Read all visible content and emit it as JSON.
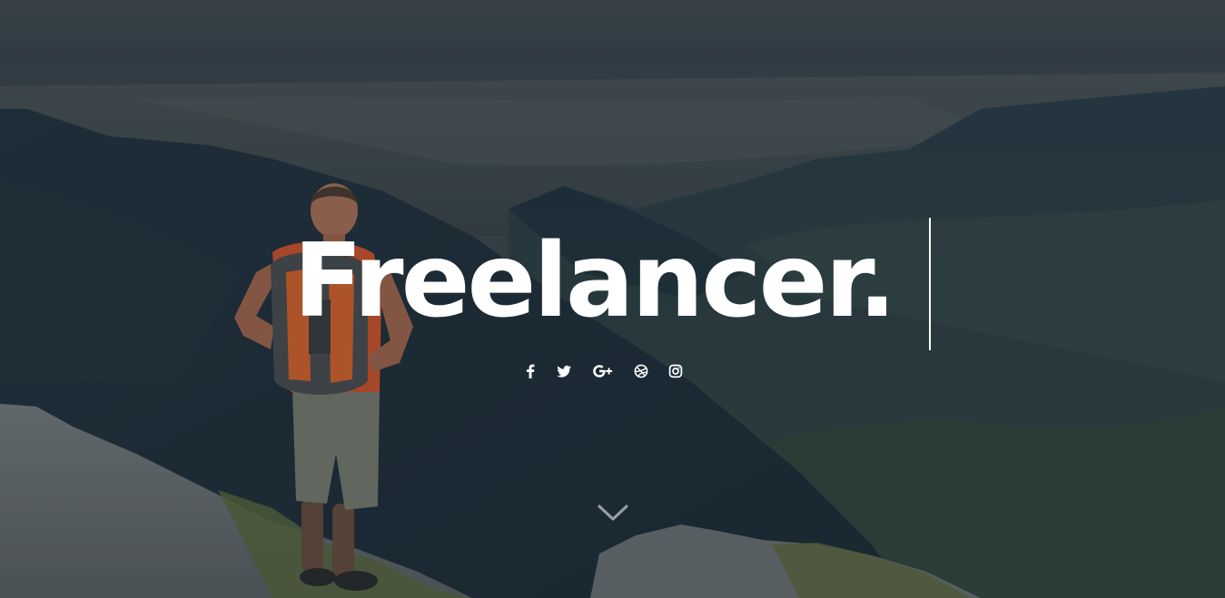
{
  "hero": {
    "headline": "Freelancer."
  },
  "social_links": [
    {
      "name": "facebook",
      "icon": "facebook-icon"
    },
    {
      "name": "twitter",
      "icon": "twitter-icon"
    },
    {
      "name": "google-plus",
      "icon": "google-plus-icon"
    },
    {
      "name": "dribbble",
      "icon": "dribbble-icon"
    },
    {
      "name": "instagram",
      "icon": "instagram-icon"
    }
  ],
  "scroll": {
    "icon": "chevron-down-icon"
  },
  "colors": {
    "text": "#ffffff",
    "overlay": "#1b2a36"
  }
}
